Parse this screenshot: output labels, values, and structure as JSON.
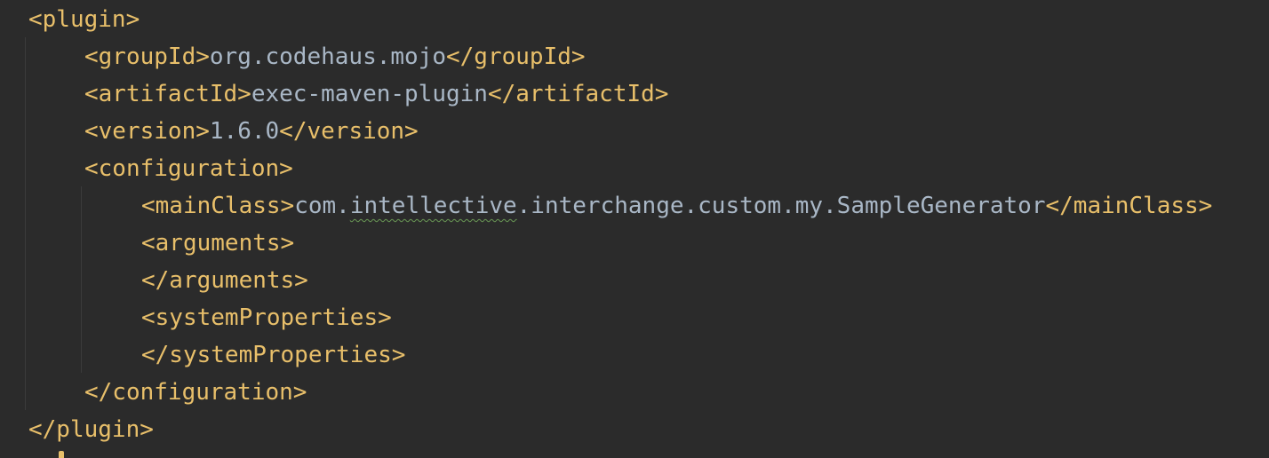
{
  "code": {
    "lines": [
      {
        "tag_open": "<plugin>"
      },
      {
        "tag_open": "<groupId>",
        "text": "org.codehaus.mojo",
        "tag_close": "</groupId>"
      },
      {
        "tag_open": "<artifactId>",
        "text": "exec-maven-plugin",
        "tag_close": "</artifactId>"
      },
      {
        "tag_open": "<version>",
        "text": "1.6.0",
        "tag_close": "</version>"
      },
      {
        "tag_open": "<configuration>"
      },
      {
        "tag_open": "<mainClass>",
        "text_pre": "com.",
        "text_flagged": "intellective",
        "text_post": ".interchange.custom.my.SampleGenerator",
        "tag_close": "</mainClass>"
      },
      {
        "tag_open": "<arguments>"
      },
      {
        "tag_open": "</arguments>"
      },
      {
        "tag_open": "<systemProperties>"
      },
      {
        "tag_open": "</systemProperties>"
      },
      {
        "tag_open": "</configuration>"
      },
      {
        "tag_open": "</plugin>"
      }
    ]
  },
  "colors": {
    "background": "#2b2b2b",
    "tag": "#e8bf6a",
    "text": "#a9b7c6",
    "indent_guide": "#3b3b3b",
    "spellcheck_underline": "#6a9955"
  }
}
